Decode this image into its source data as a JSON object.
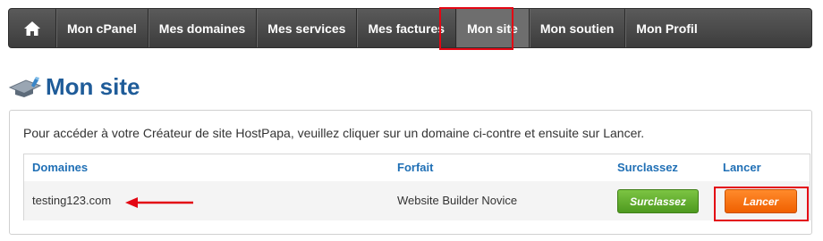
{
  "nav": {
    "items": [
      {
        "label": "Mon cPanel"
      },
      {
        "label": "Mes domaines"
      },
      {
        "label": "Mes services"
      },
      {
        "label": "Mes factures"
      },
      {
        "label": "Mon site",
        "active": true
      },
      {
        "label": "Mon soutien"
      },
      {
        "label": "Mon Profil"
      }
    ]
  },
  "page": {
    "title": "Mon site",
    "intro": "Pour accéder à votre Créateur de site HostPapa, veuillez cliquer sur un domaine ci-contre et ensuite sur Lancer."
  },
  "table": {
    "headers": {
      "domain": "Domaines",
      "plan": "Forfait",
      "upgrade": "Surclassez",
      "launch": "Lancer"
    },
    "rows": [
      {
        "domain": "testing123.com",
        "plan": "Website Builder Novice",
        "upgrade_button": "Surclassez",
        "launch_button": "Lancer"
      }
    ]
  },
  "colors": {
    "title": "#1f5c99",
    "header_link": "#1f6fb5",
    "nav_bg": "#4a4a4a",
    "upgrade_button": "#5aaa2a",
    "launch_button": "#f26b0c",
    "annotation": "#e30613"
  },
  "icons": {
    "home": "home-icon",
    "title": "mortarboard-icon",
    "annotation_arrow": "left-arrow-icon"
  }
}
